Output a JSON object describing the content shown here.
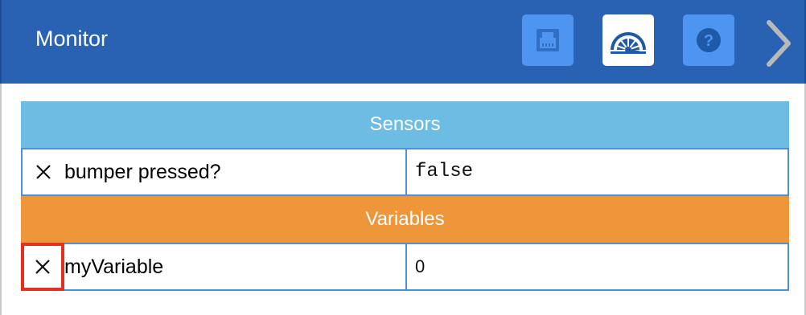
{
  "header": {
    "title": "Monitor",
    "icons": [
      {
        "name": "device-port-icon",
        "state": "inactive"
      },
      {
        "name": "gauge-icon",
        "state": "active"
      },
      {
        "name": "help-icon",
        "state": "inactive"
      },
      {
        "name": "chevron-right-icon",
        "state": "inactive"
      }
    ]
  },
  "sections": {
    "sensors": {
      "title": "Sensors",
      "rows": [
        {
          "remove_icon": "close-icon",
          "label": "bumper pressed?",
          "value": "false"
        }
      ]
    },
    "variables": {
      "title": "Variables",
      "rows": [
        {
          "remove_icon": "close-icon",
          "label": "myVariable",
          "value": "0",
          "remove_highlighted": true
        }
      ]
    }
  },
  "colors": {
    "header_bg": "#2962b3",
    "icon_inactive_bg": "#4d95f0",
    "sensors_bg": "#6dbce3",
    "variables_bg": "#f0963a",
    "row_border": "#4a8fe0",
    "highlight": "#e2321f"
  }
}
